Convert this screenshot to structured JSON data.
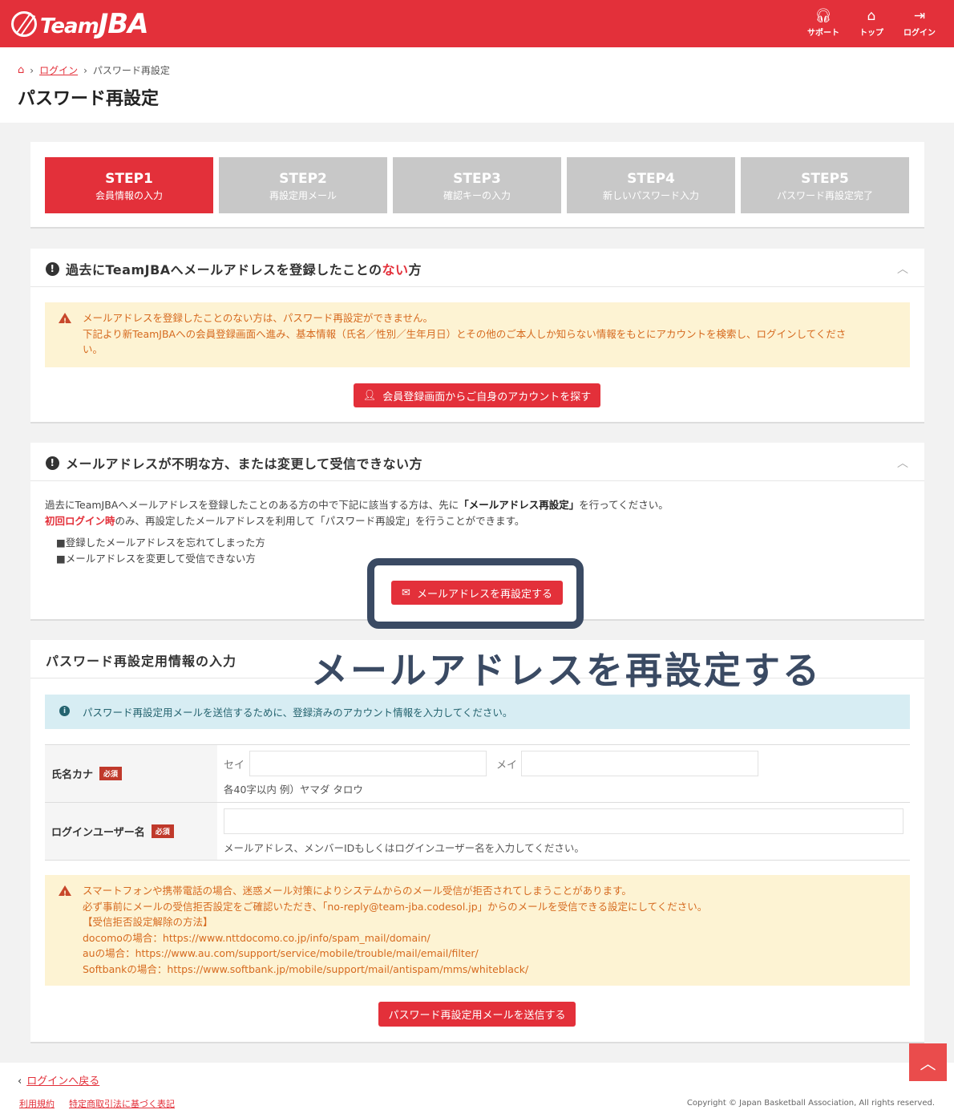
{
  "header": {
    "logo_team": "Team",
    "logo_jba": "JBA",
    "nav": [
      {
        "label": "サポート",
        "icon": "headset-icon"
      },
      {
        "label": "トップ",
        "icon": "home-icon"
      },
      {
        "label": "ログイン",
        "icon": "login-icon"
      }
    ]
  },
  "breadcrumb": {
    "login": "ログイン",
    "current": "パスワード再設定"
  },
  "page_title": "パスワード再設定",
  "steps": [
    {
      "title": "STEP1",
      "sub": "会員情報の入力"
    },
    {
      "title": "STEP2",
      "sub": "再設定用メール"
    },
    {
      "title": "STEP3",
      "sub": "確認キーの入力"
    },
    {
      "title": "STEP4",
      "sub": "新しいパスワード入力"
    },
    {
      "title": "STEP5",
      "sub": "パスワード再設定完了"
    }
  ],
  "section1": {
    "title_pre": "過去にTeamJBAへメールアドレスを登録したことの",
    "title_red": "ない",
    "title_post": "方",
    "warn_line1": "メールアドレスを登録したことのない方は、パスワード再設定ができません。",
    "warn_line2": "下記より新TeamJBAへの会員登録画面へ進み、基本情報（氏名／性別／生年月日）とその他のご本人しか知らない情報をもとにアカウントを検索し、ログインしてくださ",
    "warn_line3": "い。",
    "button": "会員登録画面からご自身のアカウントを探す"
  },
  "section2": {
    "title": "メールアドレスが不明な方、または変更して受信できない方",
    "body1_pre": "過去にTeamJBAへメールアドレスを登録したことのある方の中で下記に該当する方は、先に",
    "body1_bold": "「メールアドレス再設定」",
    "body1_post": "を行ってください。",
    "body2_red": "初回ログイン時",
    "body2_post": "のみ、再設定したメールアドレスを利用して「パスワード再設定」を行うことができます。",
    "list": [
      "■登録したメールアドレスを忘れてしまった方",
      "■メールアドレスを変更して受信できない方"
    ],
    "button": "メールアドレスを再設定する"
  },
  "overlay_caption": "メールアドレスを再設定する",
  "section3": {
    "title": "パスワード再設定用情報の入力",
    "info": "パスワード再設定用メールを送信するために、登録済みのアカウント情報を入力してください。",
    "kana_label": "氏名カナ",
    "required": "必須",
    "sei": "セイ",
    "mei": "メイ",
    "sei_value": "",
    "mei_value": "",
    "kana_hint": "各40字以内 例）ヤマダ タロウ",
    "user_label": "ログインユーザー名",
    "user_value": "",
    "user_hint": "メールアドレス、メンバーIDもしくはログインユーザー名を入力してください。",
    "warn_lines": [
      "スマートフォンや携帯電話の場合、迷惑メール対策によりシステムからのメール受信が拒否されてしまうことがあります。",
      "必ず事前にメールの受信拒否設定をご確認いただき、「no-reply@team-jba.codesol.jp」からのメールを受信できる設定にしてください。",
      "【受信拒否設定解除の方法】",
      "docomoの場合：https://www.nttdocomo.co.jp/info/spam_mail/domain/",
      "auの場合：https://www.au.com/support/service/mobile/trouble/mail/email/filter/",
      "Softbankの場合：https://www.softbank.jp/mobile/support/mail/antispam/mms/whiteblack/"
    ],
    "send_button": "パスワード再設定用メールを送信する"
  },
  "footer": {
    "back": "ログインへ戻る",
    "terms": "利用規約",
    "legal": "特定商取引法に基づく表記",
    "copyright": "Copyright © Japan Basketball Association, All rights reserved."
  }
}
